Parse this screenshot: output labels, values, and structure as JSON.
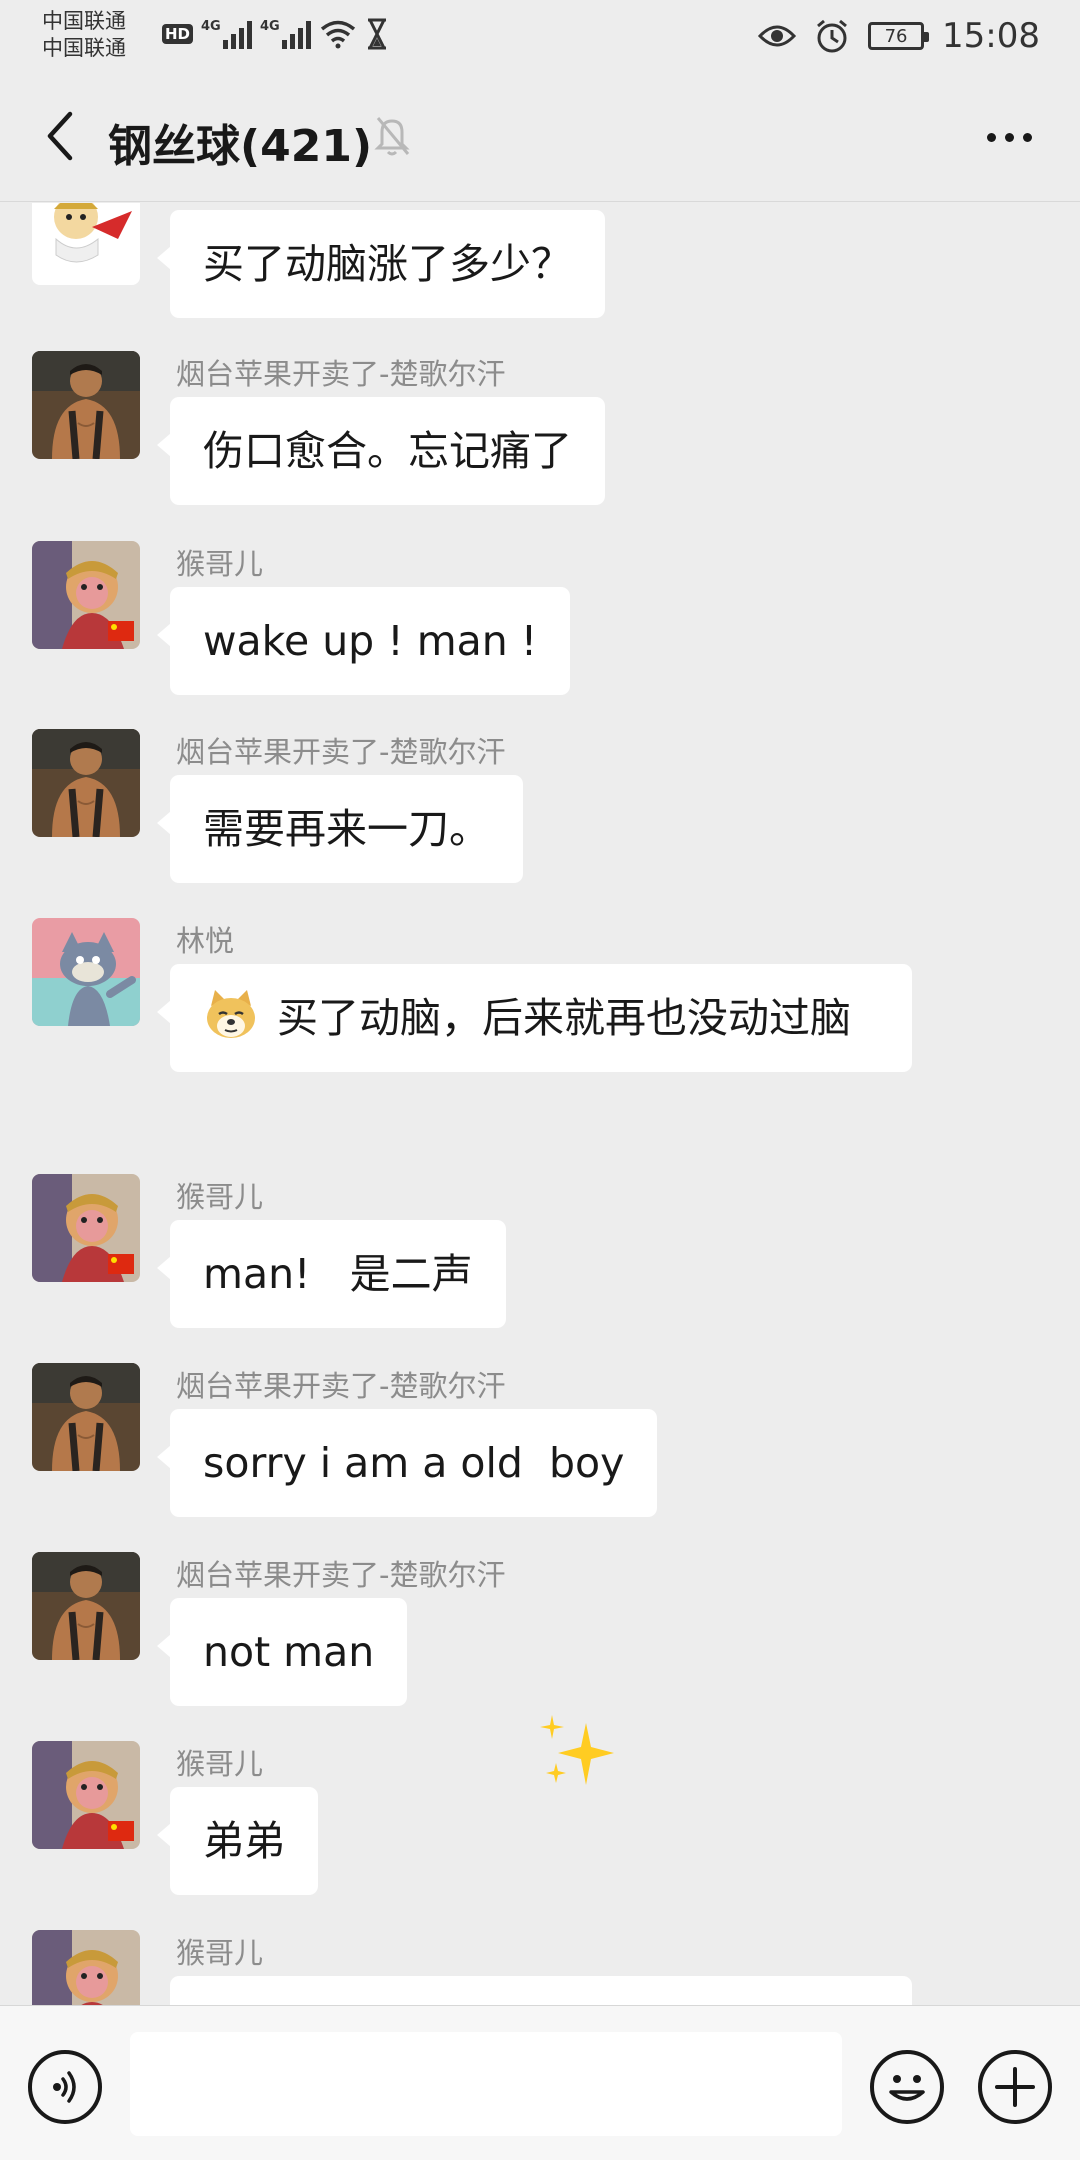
{
  "status": {
    "carrier_line1": "中国联通",
    "carrier_line2": "中国联通",
    "hd_badge": "HD",
    "network_label_1": "4G",
    "network_label_2": "4G",
    "battery_level": "76",
    "time": "15:08",
    "icons": [
      "wifi-icon",
      "hourglass-icon",
      "eye-icon",
      "alarm-icon",
      "battery-icon"
    ]
  },
  "header": {
    "title": "钢丝球(421)",
    "icons": [
      "back-icon",
      "mute-bell-icon",
      "more-icon"
    ]
  },
  "messages": [
    {
      "sender": "",
      "avatar": "cartoon-avatar",
      "text": "买了动脑涨了多少？"
    },
    {
      "sender": "烟台苹果开卖了-楚歌尔汗",
      "avatar": "muscle-man-avatar",
      "text": "伤口愈合。忘记痛了"
    },
    {
      "sender": "猴哥儿",
      "avatar": "monkey-king-avatar",
      "text": "wake up ! man !"
    },
    {
      "sender": "烟台苹果开卖了-楚歌尔汗",
      "avatar": "muscle-man-avatar",
      "text": "需要再来一刀。"
    },
    {
      "sender": "林悦",
      "avatar": "tom-cat-avatar",
      "emoji": "doge-emoji",
      "text": "买了动脑，后来就再也没动过脑"
    },
    {
      "sender": "猴哥儿",
      "avatar": "monkey-king-avatar",
      "text": "man!   是二声"
    },
    {
      "sender": "烟台苹果开卖了-楚歌尔汗",
      "avatar": "muscle-man-avatar",
      "text": "sorry i am a old  boy"
    },
    {
      "sender": "烟台苹果开卖了-楚歌尔汗",
      "avatar": "muscle-man-avatar",
      "text": "not man"
    },
    {
      "sender": "猴哥儿",
      "avatar": "monkey-king-avatar",
      "text": "弟弟"
    },
    {
      "sender": "猴哥儿",
      "avatar": "monkey-king-avatar",
      "text": ""
    }
  ],
  "input": {
    "value": "",
    "placeholder": "",
    "icons": [
      "voice-icon",
      "emoji-icon",
      "plus-icon"
    ]
  }
}
